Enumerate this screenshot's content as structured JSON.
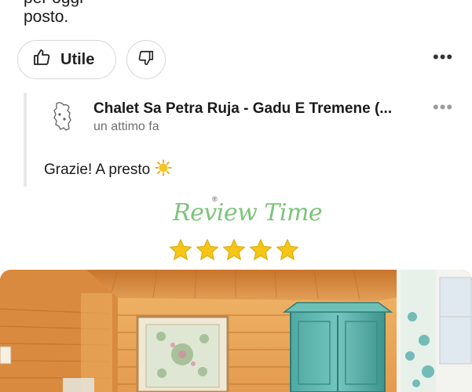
{
  "review": {
    "text_line_1_clipped": "per oggi",
    "text_line_2": "posto."
  },
  "actions": {
    "useful_label": "Utile",
    "like_icon": "thumbs-up-icon",
    "dislike_icon": "thumbs-down-icon",
    "more_icon": "more-horizontal-icon",
    "more_glyph": "•••"
  },
  "owner_reply": {
    "business_name": "Chalet Sa Petra Ruja - Gadu E Tremene (...",
    "time": "un attimo fa",
    "text": "Grazie! A presto",
    "emoji": "☀️"
  },
  "logo": {
    "text": "Review Time",
    "registered": "®"
  },
  "rating": {
    "stars": 5,
    "max": 5
  },
  "colors": {
    "brand_green": "#7cc47a",
    "star_yellow": "#f5c518",
    "wardrobe_teal": "#5cb8b0",
    "wood": "#e7a55a"
  }
}
